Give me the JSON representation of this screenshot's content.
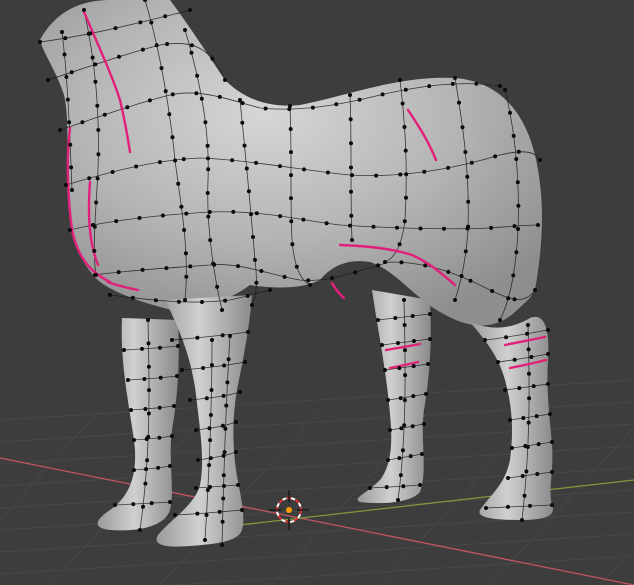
{
  "viewport": {
    "background_color": "#3d3d3d",
    "grid_line_color": "#4a4a4a",
    "x_axis_color": "#c45560",
    "y_axis_color": "#7f9a3a",
    "mesh_color": "#b8b8b8",
    "edge_color": "#1c1c1c",
    "seam_color": "#e2207a",
    "vertex_color": "#0b0b0b"
  },
  "scene_object": {
    "icon": "horse-mesh-icon",
    "mode": "edit",
    "seams_marked": true
  },
  "cursor_3d": {
    "icon": "crosshair-3d-cursor-icon",
    "ring_color_a": "#e03030",
    "ring_color_b": "#ffffff",
    "center_color": "#ff9a00"
  }
}
